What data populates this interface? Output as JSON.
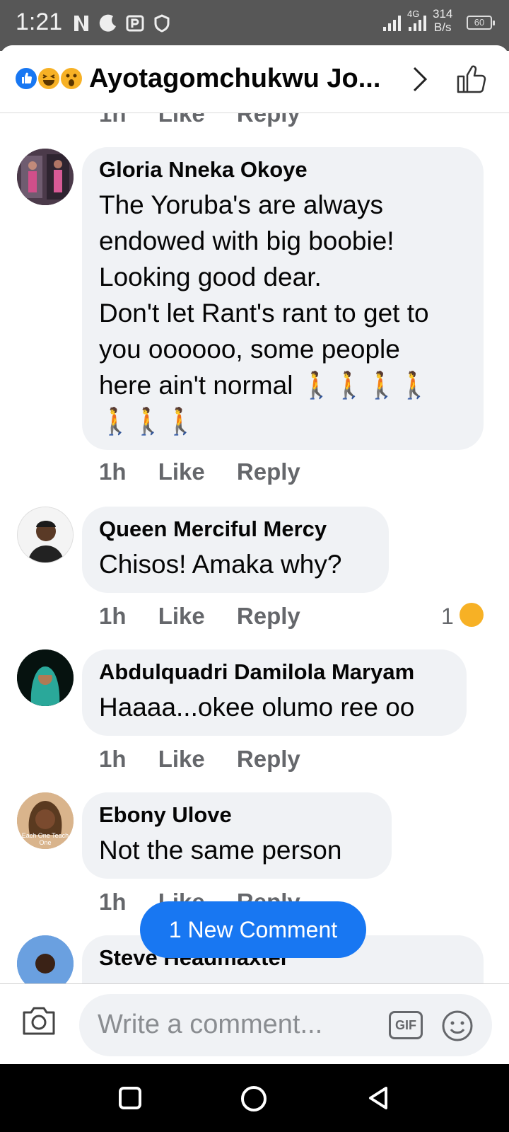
{
  "status_bar": {
    "time": "1:21",
    "network_type": "4G",
    "speed_value": "314",
    "speed_unit": "B/s",
    "battery": "60",
    "background": "#575757"
  },
  "header": {
    "title": "Ayotagomchukwu Jo...",
    "reactions": [
      "like-icon",
      "haha-icon",
      "wow-icon"
    ]
  },
  "comments": [
    {
      "author": "",
      "text": "",
      "time": "1h",
      "like": "Like",
      "reply": "Reply"
    },
    {
      "author": "Gloria Nneka Okoye",
      "text": "The Yoruba's are always\nendowed with big boobie!\nLooking good dear.\nDon't let Rant's rant to get to\nyou oooooo, some people\nhere ain't normal 🚶🚶🚶🚶\n🚶🚶🚶",
      "time": "1h",
      "like": "Like",
      "reply": "Reply"
    },
    {
      "author": "Queen Merciful Mercy",
      "text": "Chisos! Amaka why?",
      "time": "1h",
      "like": "Like",
      "reply": "Reply",
      "reaction_count": "1"
    },
    {
      "author": "Abdulquadri Damilola Maryam",
      "text": "Haaaa...okee olumo ree oo",
      "time": "1h",
      "like": "Like",
      "reply": "Reply"
    },
    {
      "author": "Ebony Ulove",
      "text": "Not the same person",
      "time": "1h",
      "like": "Like",
      "reply": "Reply",
      "avatar_caption": "Each One Teach One"
    },
    {
      "author": "Steve Headmaxter",
      "text": ""
    }
  ],
  "new_comment_button": "1 New Comment",
  "composer": {
    "placeholder": "Write a comment...",
    "gif_label": "GIF"
  },
  "colors": {
    "accent": "#1877f2",
    "bubble": "#f0f2f5",
    "meta_text": "#65676b"
  }
}
